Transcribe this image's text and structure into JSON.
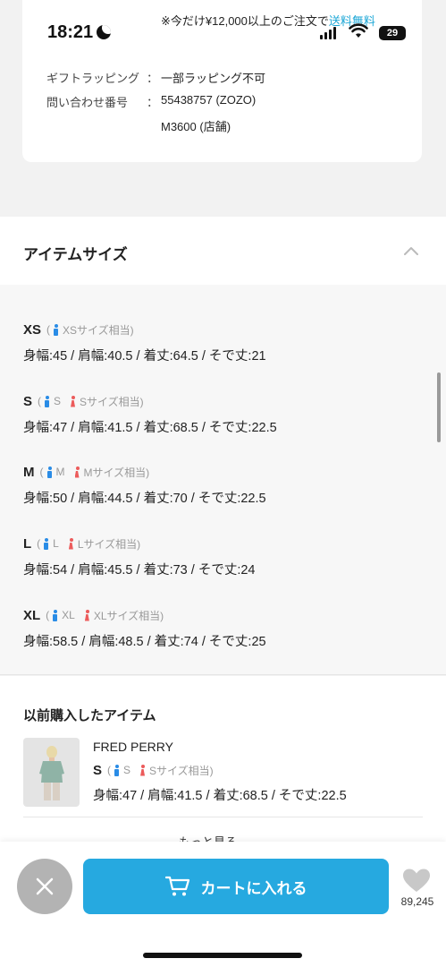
{
  "status_bar": {
    "time": "18:21",
    "battery": "29"
  },
  "top_card": {
    "notice_prefix": "※今だけ¥12,000以上のご注文で",
    "notice_link": "送料無料",
    "rows": [
      {
        "label": "ギフトラッピング",
        "colon": "：",
        "value": "一部ラッピング不可"
      },
      {
        "label": "問い合わせ番号",
        "colon": "：",
        "value": "55438757 (ZOZO)",
        "value2": "M3600 (店舗)"
      }
    ]
  },
  "item_size": {
    "title": "アイテムサイズ",
    "sizes": [
      {
        "name": "XS",
        "open": "(",
        "male": "",
        "female": "",
        "equiv": "XSサイズ相当)",
        "measure": "身幅:45 / 肩幅:40.5 / 着丈:64.5 / そで丈:21"
      },
      {
        "name": "S",
        "open": "(",
        "male": "S",
        "female": "Sサイズ相当)",
        "measure": "身幅:47 / 肩幅:41.5 / 着丈:68.5 / そで丈:22.5"
      },
      {
        "name": "M",
        "open": "(",
        "male": "M",
        "female": "Mサイズ相当)",
        "measure": "身幅:50 / 肩幅:44.5 / 着丈:70 / そで丈:22.5"
      },
      {
        "name": "L",
        "open": "(",
        "male": "L",
        "female": "Lサイズ相当)",
        "measure": "身幅:54 / 肩幅:45.5 / 着丈:73 / そで丈:24"
      },
      {
        "name": "XL",
        "open": "(",
        "male": "XL",
        "female": "XLサイズ相当)",
        "measure": "身幅:58.5 / 肩幅:48.5 / 着丈:74 / そで丈:25"
      }
    ]
  },
  "previous": {
    "title": "以前購入したアイテム",
    "brand": "FRED PERRY",
    "size_name": "S",
    "open": "(",
    "male": "S",
    "female": "Sサイズ相当)",
    "measure": "身幅:47 / 肩幅:41.5 / 着丈:68.5 / そで丈:22.5",
    "more": "もっと見る"
  },
  "bottom": {
    "cart_label": "カートに入れる",
    "fav_count": "89,245"
  },
  "colors": {
    "accent": "#26a9e0",
    "link": "#1aa6d6",
    "male": "#2a8ce6",
    "female": "#ec5b5b"
  }
}
